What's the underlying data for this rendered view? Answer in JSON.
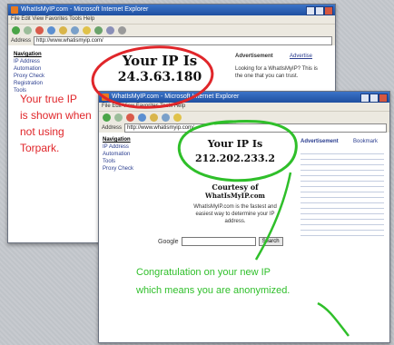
{
  "window_back": {
    "title": "WhatIsMyIP.com - Microsoft Internet Explorer",
    "menu": "File  Edit  View  Favorites  Tools  Help",
    "address_label": "Address",
    "address": "http://www.whatismyip.com/",
    "sidebar_title": "Navigation",
    "sidebar_items": [
      "IP Address",
      "Automation",
      "Proxy Check",
      "Registration",
      "Tools"
    ],
    "ip_heading": "Your IP Is",
    "ip_value": "24.3.63.180",
    "right_header_1": "Advertisement",
    "right_header_2": "Advertise",
    "right_text": "Looking for a WhatIsMyIP? This is the one that you can trust."
  },
  "window_front": {
    "title": "WhatIsMyIP.com - Microsoft Internet Explorer",
    "menu": "File  Edit  View  Favorites  Tools  Help",
    "address_label": "Address",
    "address": "http://www.whatismyip.com/",
    "sidebar_title": "Navigation",
    "sidebar_items": [
      "IP Address",
      "Automation",
      "Tools",
      "Proxy Check"
    ],
    "ip_heading": "Your IP Is",
    "ip_value": "212.202.233.2",
    "courtesy_line1": "Courtesy of",
    "courtesy_line2": "WhatIsMyIP.com",
    "description": "WhatIsMyIP.com is the fastest and easiest way to determine your IP address.",
    "google_label": "Google",
    "search_button": "Search",
    "right_header_1": "Advertisement",
    "right_header_2": "Bookmark"
  },
  "annotations": {
    "red_note": [
      "Your true IP",
      "is shown when",
      "not using",
      "Torpark."
    ],
    "green_note": [
      "Congratulation on your new IP",
      "which means you are anonymized."
    ]
  },
  "colors": {
    "red_annotation": "#e0262a",
    "green_annotation": "#2fbf2a"
  }
}
